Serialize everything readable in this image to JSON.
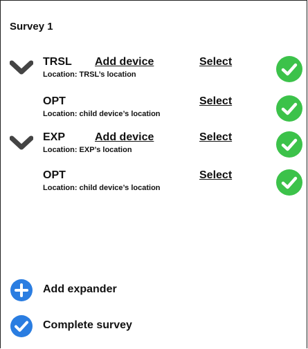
{
  "survey": {
    "title": "Survey 1"
  },
  "devices": [
    {
      "name": "TRSL",
      "add_label": "Add device",
      "select_label": "Select",
      "location": "Location: TRSL’s location"
    },
    {
      "name": "OPT",
      "select_label": "Select",
      "location": "Location: child device’s location"
    },
    {
      "name": "EXP",
      "add_label": "Add device",
      "select_label": "Select",
      "location": "Location: EXP’s location"
    },
    {
      "name": "OPT",
      "select_label": "Select",
      "location": "Location: child device’s location"
    }
  ],
  "actions": {
    "add_expander": "Add expander",
    "complete_survey": "Complete survey"
  },
  "colors": {
    "check_green": "#3cc24a",
    "action_blue": "#2a7de1",
    "chevron": "#444444"
  },
  "icons": {
    "expand": "chevron-down-icon",
    "done": "check-circle-icon",
    "add": "plus-circle-icon",
    "complete": "check-circle-blue-icon"
  }
}
